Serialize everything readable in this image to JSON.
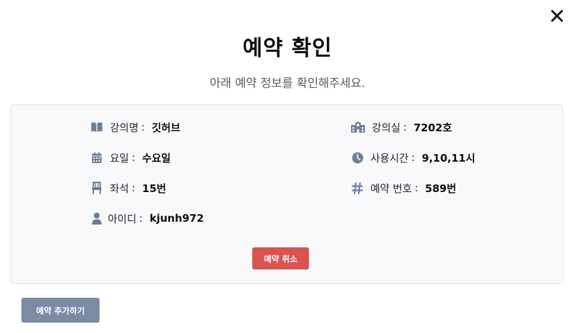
{
  "modal": {
    "title": "예약 확인",
    "subtitle": "아래 예약 정보를 확인해주세요."
  },
  "details": {
    "course_name": {
      "label": "강의명",
      "value": "깃허브",
      "icon": "book-open-icon"
    },
    "weekday": {
      "label": "요일",
      "value": "수요일",
      "icon": "calendar-icon"
    },
    "seat": {
      "label": "좌석",
      "value": "15번",
      "icon": "chair-icon"
    },
    "user_id": {
      "label": "아이디",
      "value": "kjunh972",
      "icon": "user-icon"
    },
    "classroom": {
      "label": "강의실",
      "value": "7202호",
      "icon": "school-building-icon"
    },
    "usage_time": {
      "label": "사용시간",
      "value": "9,10,11시",
      "icon": "clock-icon"
    },
    "reservation_no": {
      "label": "예약 번호",
      "value": "589번",
      "icon": "hashtag-icon"
    }
  },
  "actions": {
    "cancel_label": "예약 취소",
    "add_label": "예약 추가하기"
  },
  "colors": {
    "icon": "#6b7f99",
    "cancel": "#d9534f",
    "add": "#7a8ba3",
    "card_bg": "#f7f9fb"
  }
}
